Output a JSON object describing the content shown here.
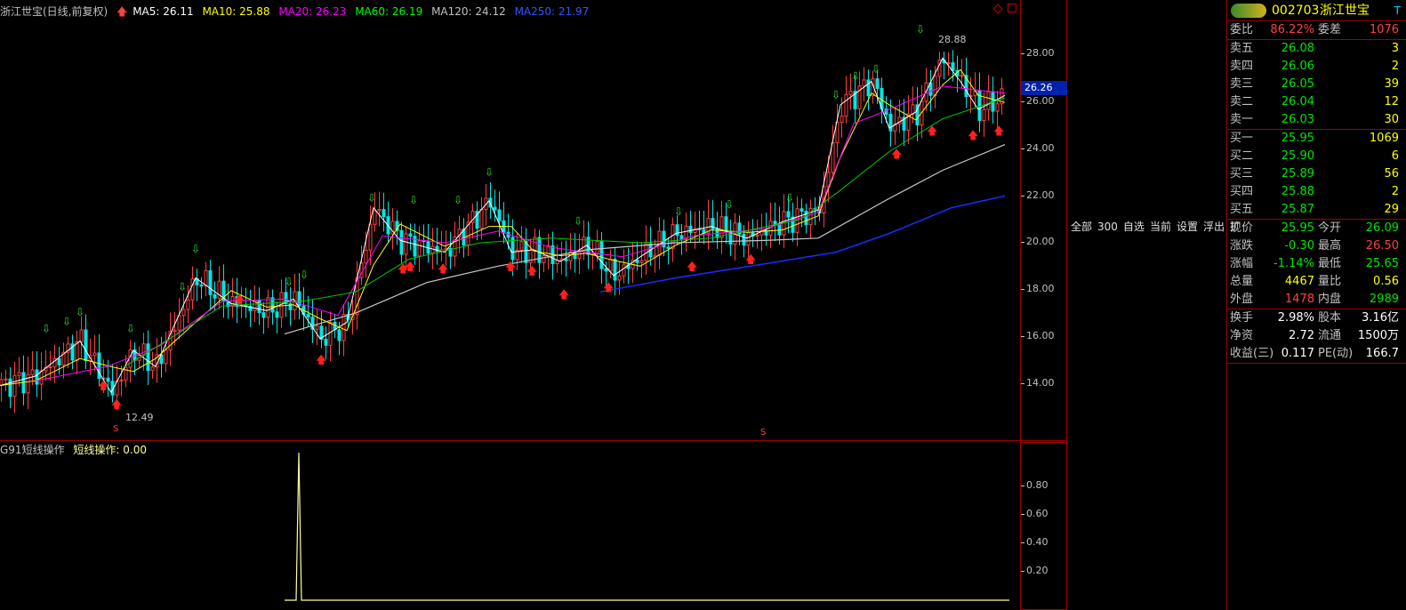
{
  "main_legend": {
    "title": "浙江世宝(日线,前复权)",
    "ma5": "MA5: 26.11",
    "ma10": "MA10: 25.88",
    "ma20": "MA20: 26.23",
    "ma60": "MA60: 26.19",
    "ma120": "MA120: 24.12",
    "ma250": "MA250: 21.97"
  },
  "main_labels": {
    "high_label": "28.88",
    "low_label": "12.49",
    "s_marker": "S"
  },
  "sub_legend": {
    "name": "G91短线操作",
    "value": "短线操作: 0.00"
  },
  "y_axis_main": [
    "28.00",
    "26.00",
    "24.00",
    "22.00",
    "20.00",
    "18.00",
    "16.00",
    "14.00"
  ],
  "current_price_tag": "26.26",
  "y_axis_sub": [
    "0.80",
    "0.60",
    "0.40",
    "0.20"
  ],
  "nav_links": [
    "全部",
    "300",
    "自选",
    "当前",
    "设置",
    "浮出",
    "扩"
  ],
  "colors": {
    "ma5": "#ffffff",
    "ma10": "#ffff00",
    "ma20": "#ff00ff",
    "ma60": "#00ff00",
    "ma120": "#c0c0c0",
    "ma250": "#0000ff",
    "up": "#ff4040",
    "down": "#00e600",
    "frame": "#a00000"
  },
  "quote": {
    "code": "002703",
    "name": "浙江世宝",
    "badge": "T",
    "weibi_label": "委比",
    "weibi_value": "86.22%",
    "weicha_label": "委差",
    "weicha_value": "1076",
    "sells": [
      {
        "label": "卖五",
        "price": "26.08",
        "vol": "3"
      },
      {
        "label": "卖四",
        "price": "26.06",
        "vol": "2"
      },
      {
        "label": "卖三",
        "price": "26.05",
        "vol": "39"
      },
      {
        "label": "卖二",
        "price": "26.04",
        "vol": "12"
      },
      {
        "label": "卖一",
        "price": "26.03",
        "vol": "30"
      }
    ],
    "buys": [
      {
        "label": "买一",
        "price": "25.95",
        "vol": "1069"
      },
      {
        "label": "买二",
        "price": "25.90",
        "vol": "6"
      },
      {
        "label": "买三",
        "price": "25.89",
        "vol": "56"
      },
      {
        "label": "买四",
        "price": "25.88",
        "vol": "2"
      },
      {
        "label": "买五",
        "price": "25.87",
        "vol": "29"
      }
    ],
    "stats": [
      {
        "l1": "现价",
        "v1": "25.95",
        "c1": "green",
        "l2": "今开",
        "v2": "26.09",
        "c2": "green"
      },
      {
        "l1": "涨跌",
        "v1": "-0.30",
        "c1": "green",
        "l2": "最高",
        "v2": "26.50",
        "c2": "red"
      },
      {
        "l1": "涨幅",
        "v1": "-1.14%",
        "c1": "green",
        "l2": "最低",
        "v2": "25.65",
        "c2": "green"
      },
      {
        "l1": "总量",
        "v1": "4467",
        "c1": "yellow",
        "l2": "量比",
        "v2": "0.56",
        "c2": "yellow"
      },
      {
        "l1": "外盘",
        "v1": "1478",
        "c1": "red",
        "l2": "内盘",
        "v2": "2989",
        "c2": "green"
      }
    ],
    "fundamentals": [
      {
        "l1": "换手",
        "v1": "2.98%",
        "l2": "股本",
        "v2": "3.16亿"
      },
      {
        "l1": "净资",
        "v1": "2.72",
        "l2": "流通",
        "v2": "1500万"
      },
      {
        "l1": "收益(三)",
        "v1": "0.117",
        "l2": "PE(动)",
        "v2": "166.7"
      }
    ]
  }
}
